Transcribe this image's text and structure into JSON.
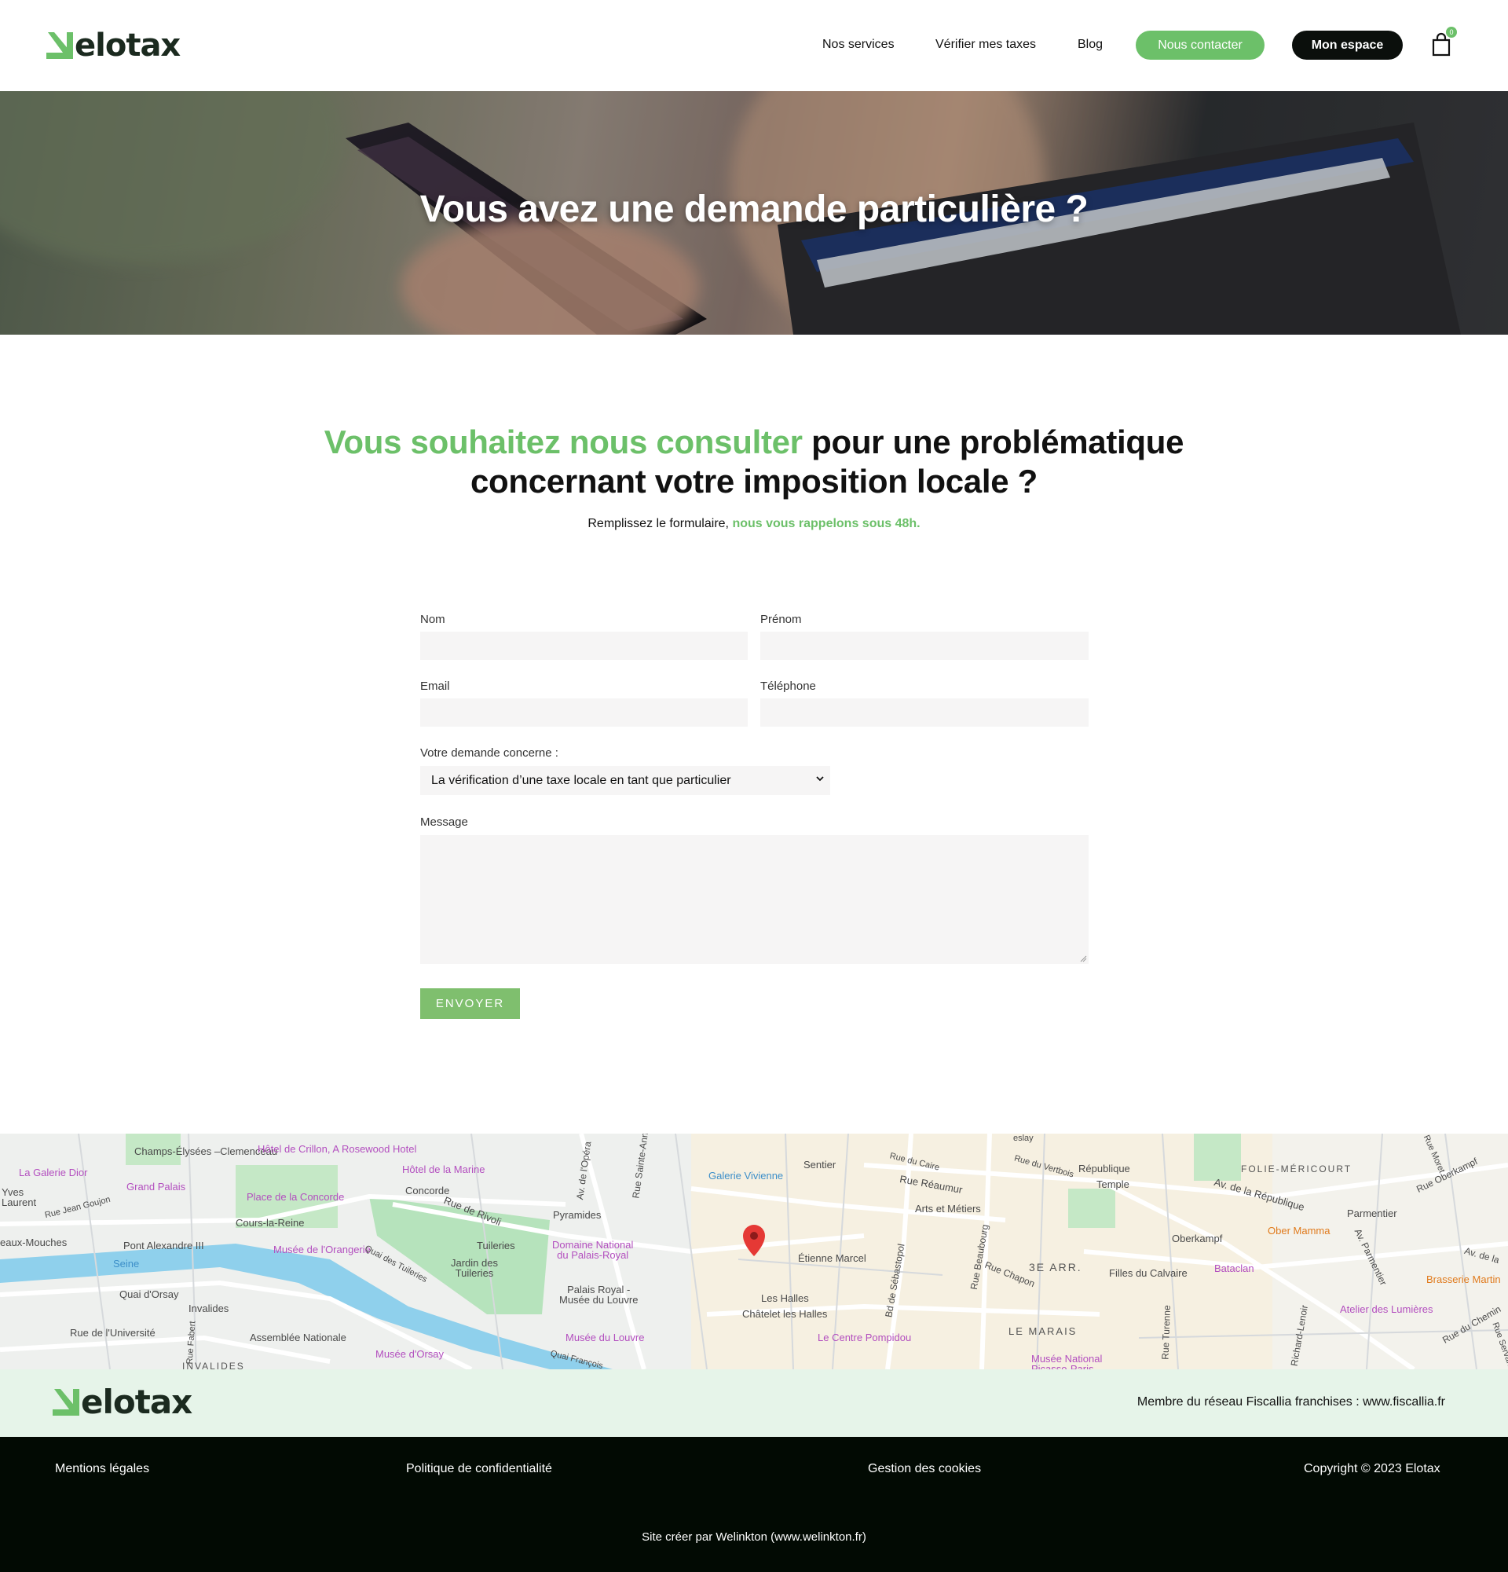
{
  "brand": {
    "name": "elotax",
    "accent_color": "#6cc069",
    "dark_color": "#0b0f0c"
  },
  "nav": {
    "items": [
      {
        "label": "Nos services"
      },
      {
        "label": "Vérifier mes taxes"
      },
      {
        "label": "Blog"
      }
    ],
    "contact_label": "Nous contacter",
    "space_label": "Mon espace",
    "cart_icon": "shopping-bag-icon",
    "cart_count": "0"
  },
  "hero": {
    "title": "Vous avez une demande particulière ?"
  },
  "intro": {
    "title_highlight": "Vous souhaitez nous consulter",
    "title_rest_line1": " pour une problématique",
    "title_line2": "concernant votre imposition locale ?",
    "sub_text": "Remplissez le formulaire, ",
    "sub_highlight": "nous vous rappelons sous 48h."
  },
  "form": {
    "nom_label": "Nom",
    "prenom_label": "Prénom",
    "email_label": "Email",
    "telephone_label": "Téléphone",
    "demande_label": "Votre demande concerne :",
    "demande_selected": "La vérification d’une taxe locale en tant que particulier",
    "message_label": "Message",
    "submit_label": "ENVOYER"
  },
  "map": {
    "labels": [
      "Champs-Élysées\n–Clemenceau",
      "Hôtel de Crillon,\nA Rosewood Hotel",
      "Hôtel de la Marine",
      "La Galerie Dior",
      "Grand Palais",
      "Place de la Concorde",
      "Concorde",
      "Rue Jean Goujon",
      "Cours-la-Reine",
      "Pont Alexandre III",
      "Musée de l'Orangerie",
      "Seine",
      "Quai d'Orsay",
      "Invalides",
      "Rue de l'Université",
      "Assemblée Nationale",
      "Musée d'Orsay",
      "INVALIDES",
      "Rue de Rivoli",
      "Tuileries",
      "Jardin des\nTuileries",
      "Quai des Tuileries",
      "Pyramides",
      "Domaine National\ndu Palais-Royal",
      "Palais Royal -\nMusée du Louvre",
      "Musée du Louvre",
      "Galerie Vivienne",
      "Sentier",
      "Rue du Caire",
      "Rue Réaumur",
      "Arts et Métiers",
      "Étienne Marcel",
      "Les Halles",
      "Châtelet les Halles",
      "Le Centre Pompidou",
      "Bd de Sébastopol",
      "Rue Beaubourg",
      "Rue Chapon",
      "3E ARR.",
      "LE MARAIS",
      "Musée National\nPicasso-Paris",
      "République",
      "Temple",
      "Rue du Vertbois",
      "Filles du Calvaire",
      "Bataclan",
      "Oberkampf",
      "Ober Mamma",
      "Parmentier",
      "Av. de la République",
      "FOLIE-MÉRICOURT",
      "Rue Oberkampf",
      "Brasserie Martin",
      "Atelier des Lumières",
      "Av. de la",
      "Av. Parmentier",
      "Rue Turenne",
      "Richard-Lenoir",
      "Yves\nLaurent",
      "eaux-Mouches",
      "Av. de l'Opéra",
      "Rue Sainte-Anne",
      "Rue Fabert",
      "Quai François",
      "Rue du Chemin",
      "Rue Servan",
      "Rue Moret",
      "eslay"
    ]
  },
  "footer": {
    "network": "Membre du réseau Fiscallia franchises : www.fiscallia.fr",
    "links": [
      "Mentions légales",
      "Politique de confidentialité",
      "Gestion des cookies"
    ],
    "copyright": "Copyright © 2023 Elotax",
    "credit": "Site créer par Welinkton (www.welinkton.fr)"
  }
}
